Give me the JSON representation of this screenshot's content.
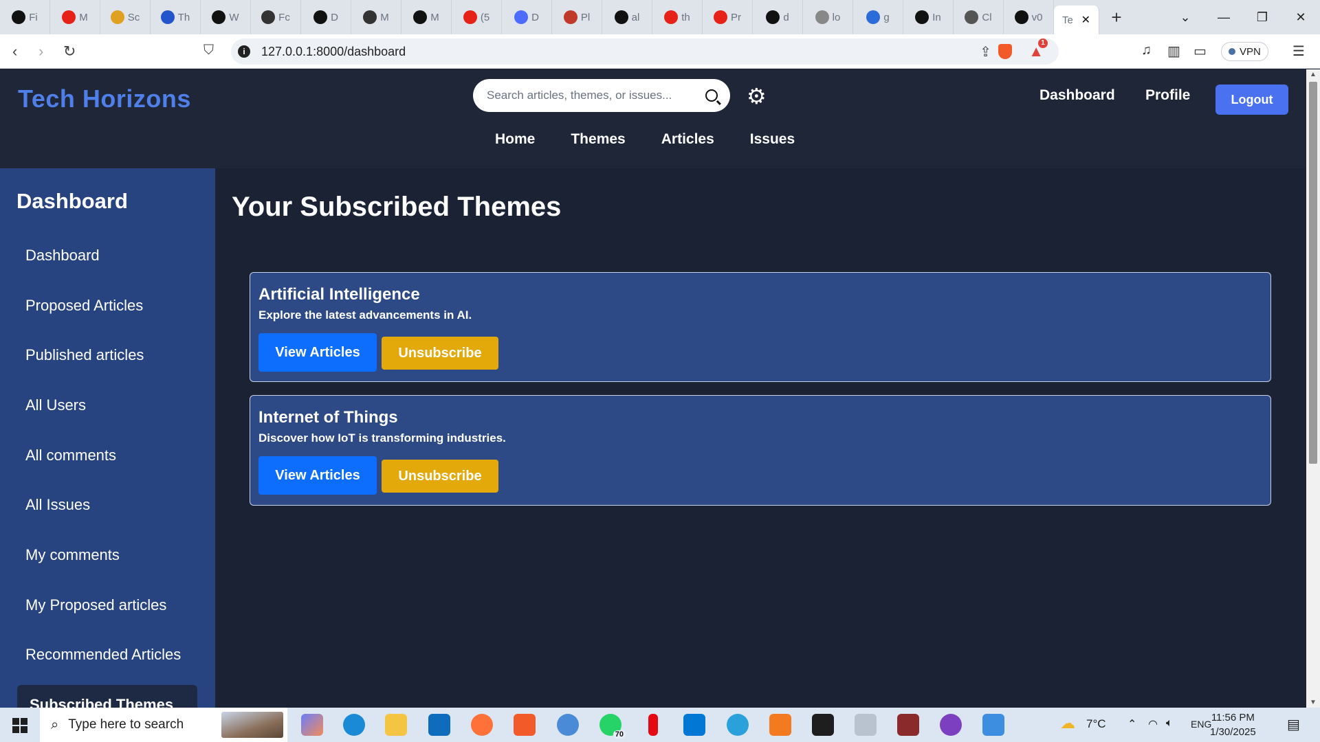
{
  "browser": {
    "tabs": [
      {
        "label": "Fi",
        "icon": "github-icon",
        "color": "#111111"
      },
      {
        "label": "M",
        "icon": "youtube-icon",
        "color": "#e62117"
      },
      {
        "label": "Sc",
        "icon": "brand-icon",
        "color": "#e0a020"
      },
      {
        "label": "Th",
        "icon": "power-icon",
        "color": "#2255cc"
      },
      {
        "label": "W",
        "icon": "m-logo-icon",
        "color": "#111111"
      },
      {
        "label": "Fc",
        "icon": "openai-icon",
        "color": "#333333"
      },
      {
        "label": "D",
        "icon": "github-icon",
        "color": "#111111"
      },
      {
        "label": "M",
        "icon": "profile-icon",
        "color": "#333333"
      },
      {
        "label": "M",
        "icon": "github-icon",
        "color": "#111111"
      },
      {
        "label": "(5",
        "icon": "youtube-icon",
        "color": "#e62117"
      },
      {
        "label": "D",
        "icon": "deepseek-icon",
        "color": "#4d6bfe"
      },
      {
        "label": "Pl",
        "icon": "plugin-icon",
        "color": "#c0392b"
      },
      {
        "label": "al",
        "icon": "github-icon",
        "color": "#111111"
      },
      {
        "label": "th",
        "icon": "youtube-icon",
        "color": "#e62117"
      },
      {
        "label": "Pr",
        "icon": "youtube-icon",
        "color": "#e62117"
      },
      {
        "label": "d",
        "icon": "github-icon",
        "color": "#111111"
      },
      {
        "label": "lo",
        "icon": "mountain-icon",
        "color": "#888888"
      },
      {
        "label": "g",
        "icon": "w-logo-icon",
        "color": "#2b6cd8"
      },
      {
        "label": "In",
        "icon": "openai-icon",
        "color": "#111111"
      },
      {
        "label": "Cl",
        "icon": "openai-icon",
        "color": "#555555"
      },
      {
        "label": "v0",
        "icon": "v0-icon",
        "color": "#111111"
      }
    ],
    "active_tab": "Te",
    "url": "127.0.0.1:8000/dashboard",
    "vpn_label": "VPN",
    "rewards_count": "1"
  },
  "header": {
    "logo": "Tech Horizons",
    "search_placeholder": "Search articles, themes, or issues...",
    "links": {
      "dashboard": "Dashboard",
      "profile": "Profile"
    },
    "logout": "Logout",
    "nav": [
      "Home",
      "Themes",
      "Articles",
      "Issues"
    ]
  },
  "sidebar": {
    "title": "Dashboard",
    "items": [
      "Dashboard",
      "Proposed Articles",
      "Published articles",
      "All Users",
      "All comments",
      "All Issues",
      "My comments",
      "My Proposed articles",
      "Recommended Articles"
    ],
    "active_item": "Subscribed Themes"
  },
  "main": {
    "title": "Your Subscribed Themes",
    "themes": [
      {
        "name": "Artificial Intelligence",
        "description": "Explore the latest advancements in AI.",
        "view_label": "View Articles",
        "unsubscribe_label": "Unsubscribe"
      },
      {
        "name": "Internet of Things",
        "description": "Discover how IoT is transforming industries.",
        "view_label": "View Articles",
        "unsubscribe_label": "Unsubscribe"
      }
    ]
  },
  "taskbar": {
    "search_text": "Type here to search",
    "whatsapp_badge": "70",
    "weather": "7°C",
    "language": "ENG",
    "time": "11:56 PM",
    "date": "1/30/2025"
  }
}
